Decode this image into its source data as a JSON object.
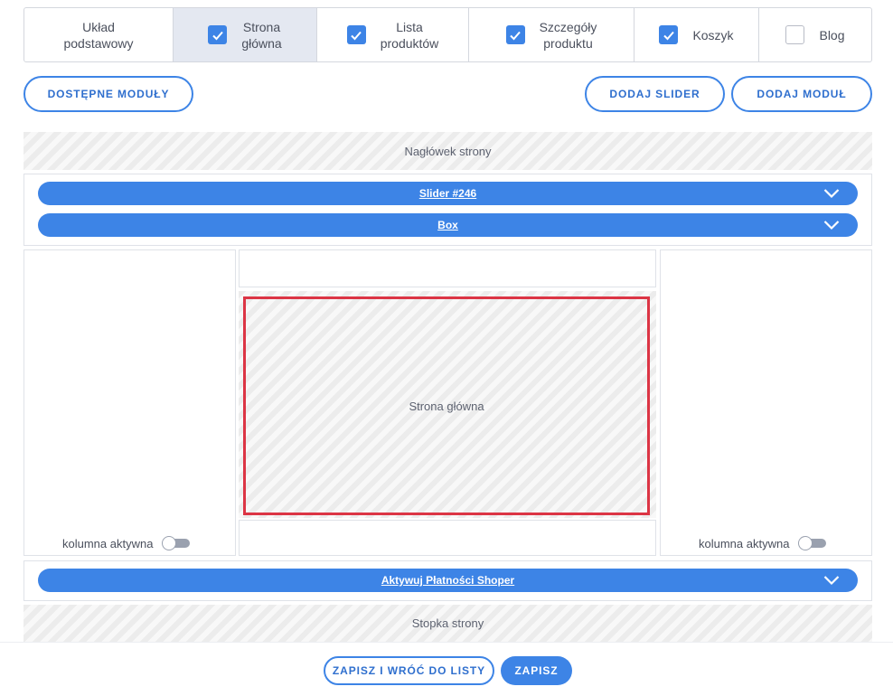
{
  "tabs": [
    {
      "label": "Układ\npodstawowy",
      "checkbox": "none",
      "active": false
    },
    {
      "label": "Strona\ngłówna",
      "checkbox": "checked",
      "active": true
    },
    {
      "label": "Lista\nproduktów",
      "checkbox": "checked",
      "active": false
    },
    {
      "label": "Szczegóły\nproduktu",
      "checkbox": "checked",
      "active": false
    },
    {
      "label": "Koszyk",
      "checkbox": "checked",
      "active": false
    },
    {
      "label": "Blog",
      "checkbox": "unchecked",
      "active": false
    }
  ],
  "toolbar": {
    "available_modules": "DOSTĘPNE MODUŁY",
    "add_slider": "DODAJ SLIDER",
    "add_module": "DODAJ MODUŁ"
  },
  "layout": {
    "header_zone": "Nagłówek strony",
    "top_modules": [
      {
        "label": "Slider #246"
      },
      {
        "label": "Box"
      }
    ],
    "main_zone": "Strona główna",
    "left_column_toggle_label": "kolumna aktywna",
    "right_column_toggle_label": "kolumna aktywna",
    "bottom_module": "Aktywuj Płatności Shoper",
    "footer_zone": "Stopka strony"
  },
  "actions": {
    "save_and_return": "ZAPISZ I WRÓĆ DO LISTY",
    "save": "ZAPISZ"
  },
  "colors": {
    "accent": "#3d84e6",
    "selected_border": "#dc3545"
  },
  "icons": {
    "checkbox_checked": "check-icon",
    "module_bar": "chevron-down-icon"
  }
}
